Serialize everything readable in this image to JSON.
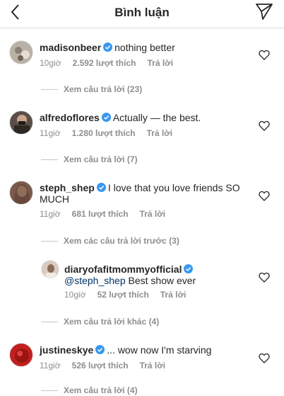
{
  "header": {
    "title": "Bình luận"
  },
  "comments": [
    {
      "username": "madisonbeer",
      "text": "nothing better",
      "time": "10giờ",
      "likes": "2.592 lượt thích",
      "reply": "Trả lời",
      "replies_link": "Xem câu trả lời (23)",
      "avatar_color": "#b9b0a6"
    },
    {
      "username": "alfredoflores",
      "text": "Actually — the best.",
      "time": "11giờ",
      "likes": "1.280 lượt thích",
      "reply": "Trả lời",
      "replies_link": "Xem câu trả lời (7)",
      "avatar_color": "#5a4e47"
    },
    {
      "username": "steph_shep",
      "text": "I love that you love friends SO MUCH",
      "time": "11giờ",
      "likes": "681 lượt thích",
      "reply": "Trả lời",
      "replies_link": "Xem các câu trả lời trước (3)",
      "avatar_color": "#7a5a4c"
    },
    {
      "username": "diaryofafitmommyofficial",
      "mention": "@steph_shep",
      "text": "Best show ever",
      "time": "10giờ",
      "likes": "52 lượt thích",
      "reply": "Trả lời",
      "replies_link": "Xem câu trả lời khác (4)",
      "avatar_color": "#d8cbc0"
    },
    {
      "username": "justineskye",
      "text": "... wow now I'm starving",
      "time": "11giờ",
      "likes": "526 lượt thích",
      "reply": "Trả lời",
      "replies_link": "Xem câu trả lời (4)",
      "avatar_color": "#c0201e"
    }
  ],
  "colors": {
    "verified": "#3897f0",
    "text": "#262626",
    "meta": "#8e8e8e",
    "divider": "#dbdbdb"
  }
}
